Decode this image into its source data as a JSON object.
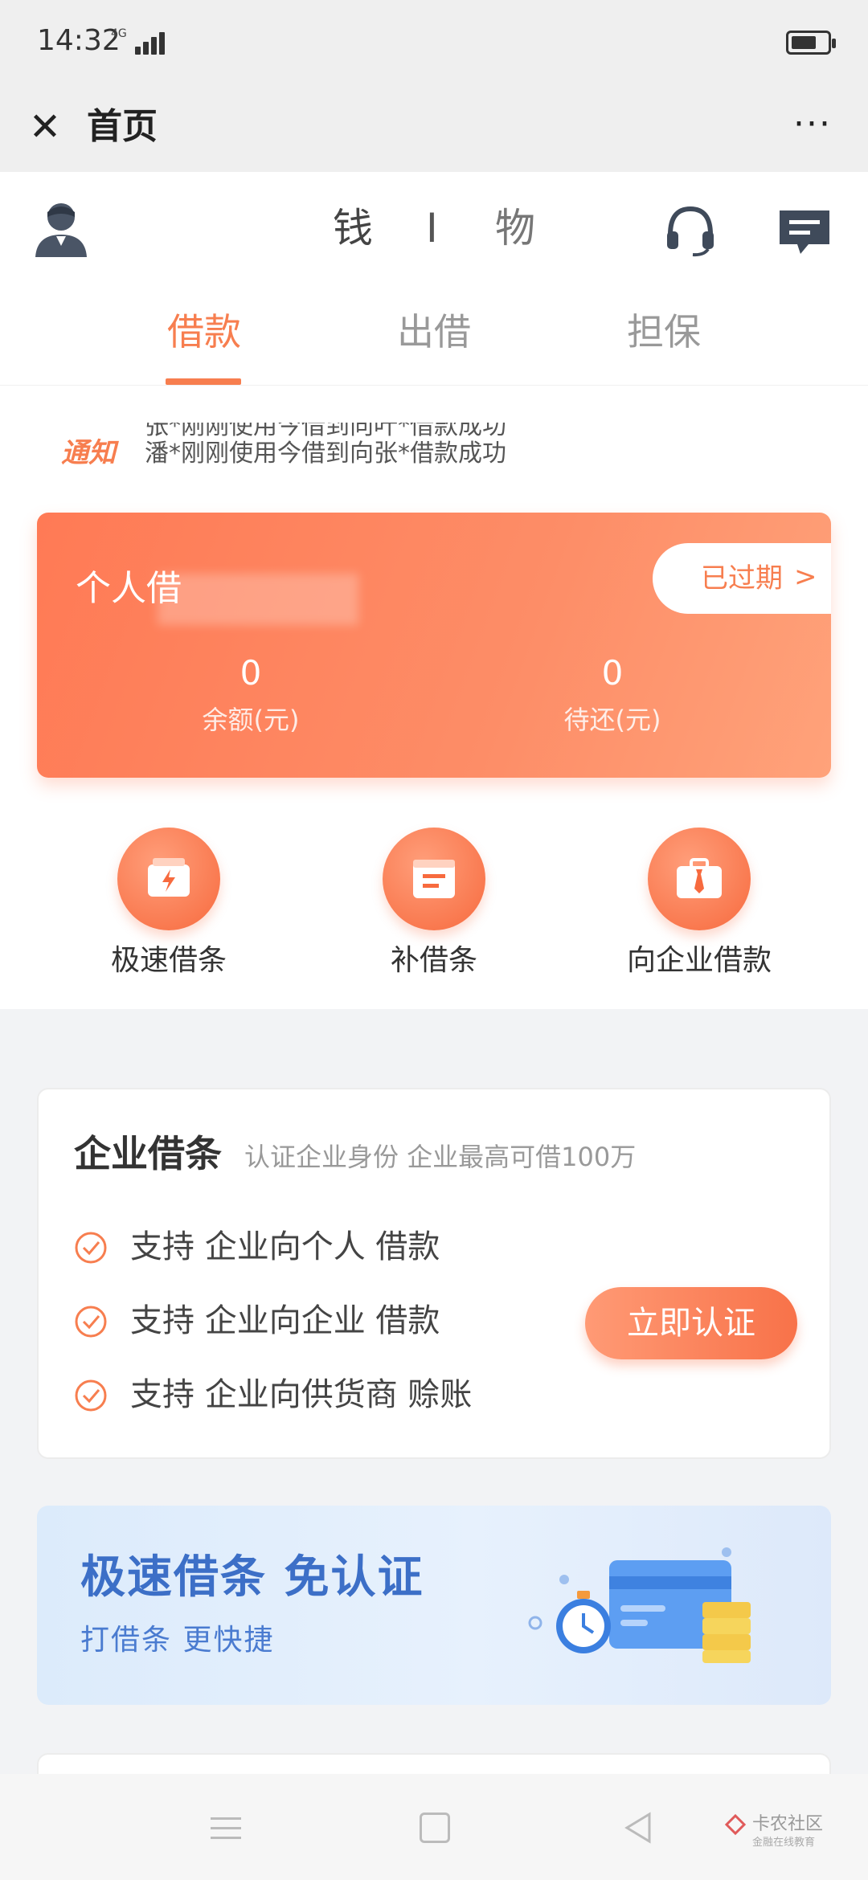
{
  "status_bar": {
    "time": "14:32",
    "network": "4G"
  },
  "title_bar": {
    "title": "首页",
    "more_label": "···"
  },
  "header": {
    "brand_left": "钱",
    "brand_sep": "I",
    "brand_right": "物"
  },
  "tabs": [
    {
      "label": "借款",
      "active": true
    },
    {
      "label": "出借",
      "active": false
    },
    {
      "label": "担保",
      "active": false
    }
  ],
  "notice": {
    "tag": "通知",
    "lines": [
      "张*刚刚使用今借到向叶*借款成功",
      "潘*刚刚使用今借到向张*借款成功"
    ]
  },
  "loan_card": {
    "title": "个人借",
    "status": "已过期",
    "status_arrow": ">",
    "metrics": [
      {
        "value": "0",
        "label": "余额(元)"
      },
      {
        "value": "0",
        "label": "待还(元)"
      }
    ]
  },
  "quick_actions": [
    {
      "label": "极速借条",
      "icon": "lightning-document-icon"
    },
    {
      "label": "补借条",
      "icon": "document-icon"
    },
    {
      "label": "向企业借款",
      "icon": "briefcase-icon"
    }
  ],
  "enterprise": {
    "title": "企业借条",
    "subtitle": "认证企业身份 企业最高可借100万",
    "items": [
      "支持 企业向个人 借款",
      "支持 企业向企业 借款",
      "支持 企业向供货商 赊账"
    ],
    "button_label": "立即认证"
  },
  "promo": {
    "title": "极速借条 免认证",
    "subtitle": "打借条 更快捷"
  },
  "watermark": {
    "title": "卡农社区",
    "subtitle": "金融在线教育"
  },
  "colors": {
    "accent": "#f77e4f",
    "promo_blue": "#3c6fc7",
    "card_gradient_start": "#ff7a55",
    "card_gradient_end": "#ffa27a"
  }
}
